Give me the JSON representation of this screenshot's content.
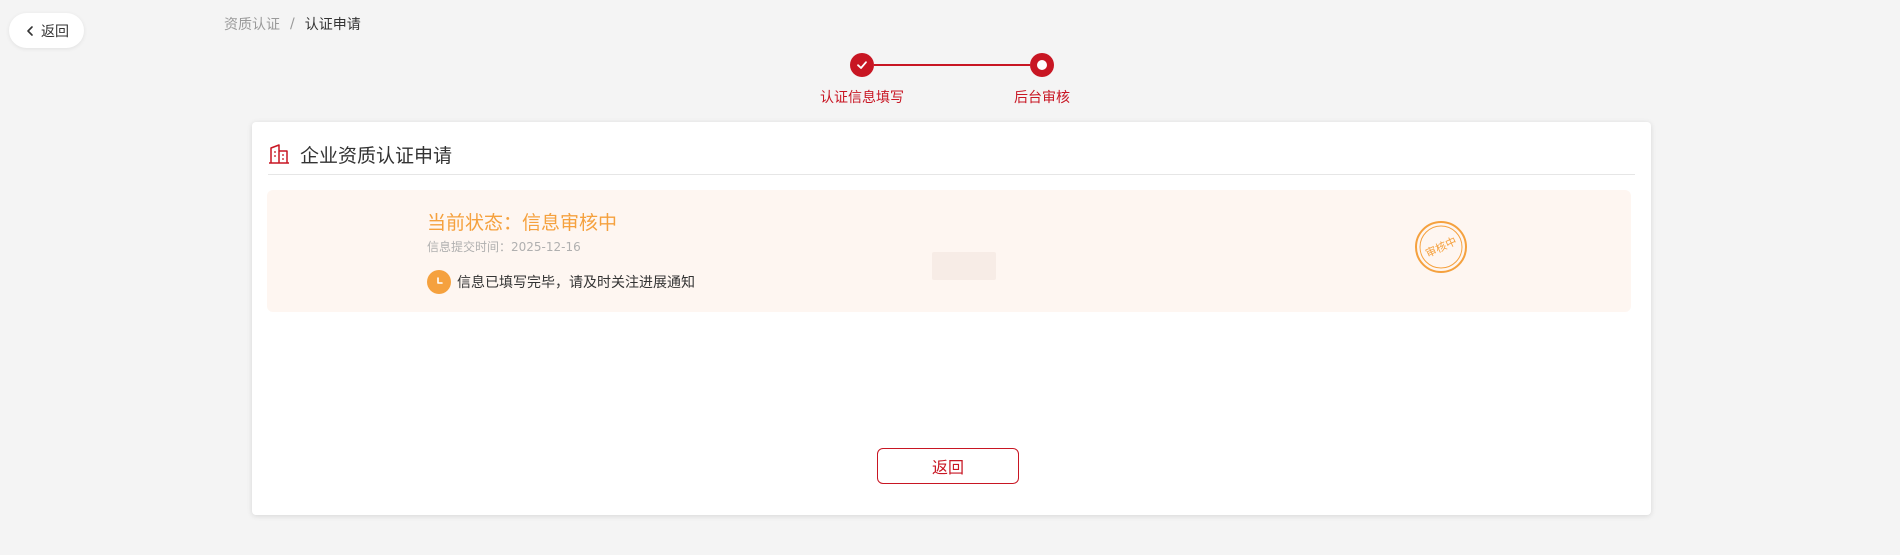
{
  "nav": {
    "back_label": "返回"
  },
  "breadcrumb": {
    "parent": "资质认证",
    "separator": "/",
    "current": "认证申请"
  },
  "steps": [
    {
      "label": "认证信息填写",
      "state": "done"
    },
    {
      "label": "后台审核",
      "state": "active"
    }
  ],
  "card": {
    "title": "企业资质认证申请",
    "status": {
      "title": "当前状态：信息审核中",
      "submit_time": "信息提交时间：2025-12-16",
      "note": "信息已填写完毕，请及时关注进展通知",
      "stamp_text": "审核中"
    },
    "back_button_label": "返回"
  },
  "colors": {
    "accent": "#c81623",
    "status_orange": "#f5a13e",
    "status_bg": "#fef6f1"
  }
}
